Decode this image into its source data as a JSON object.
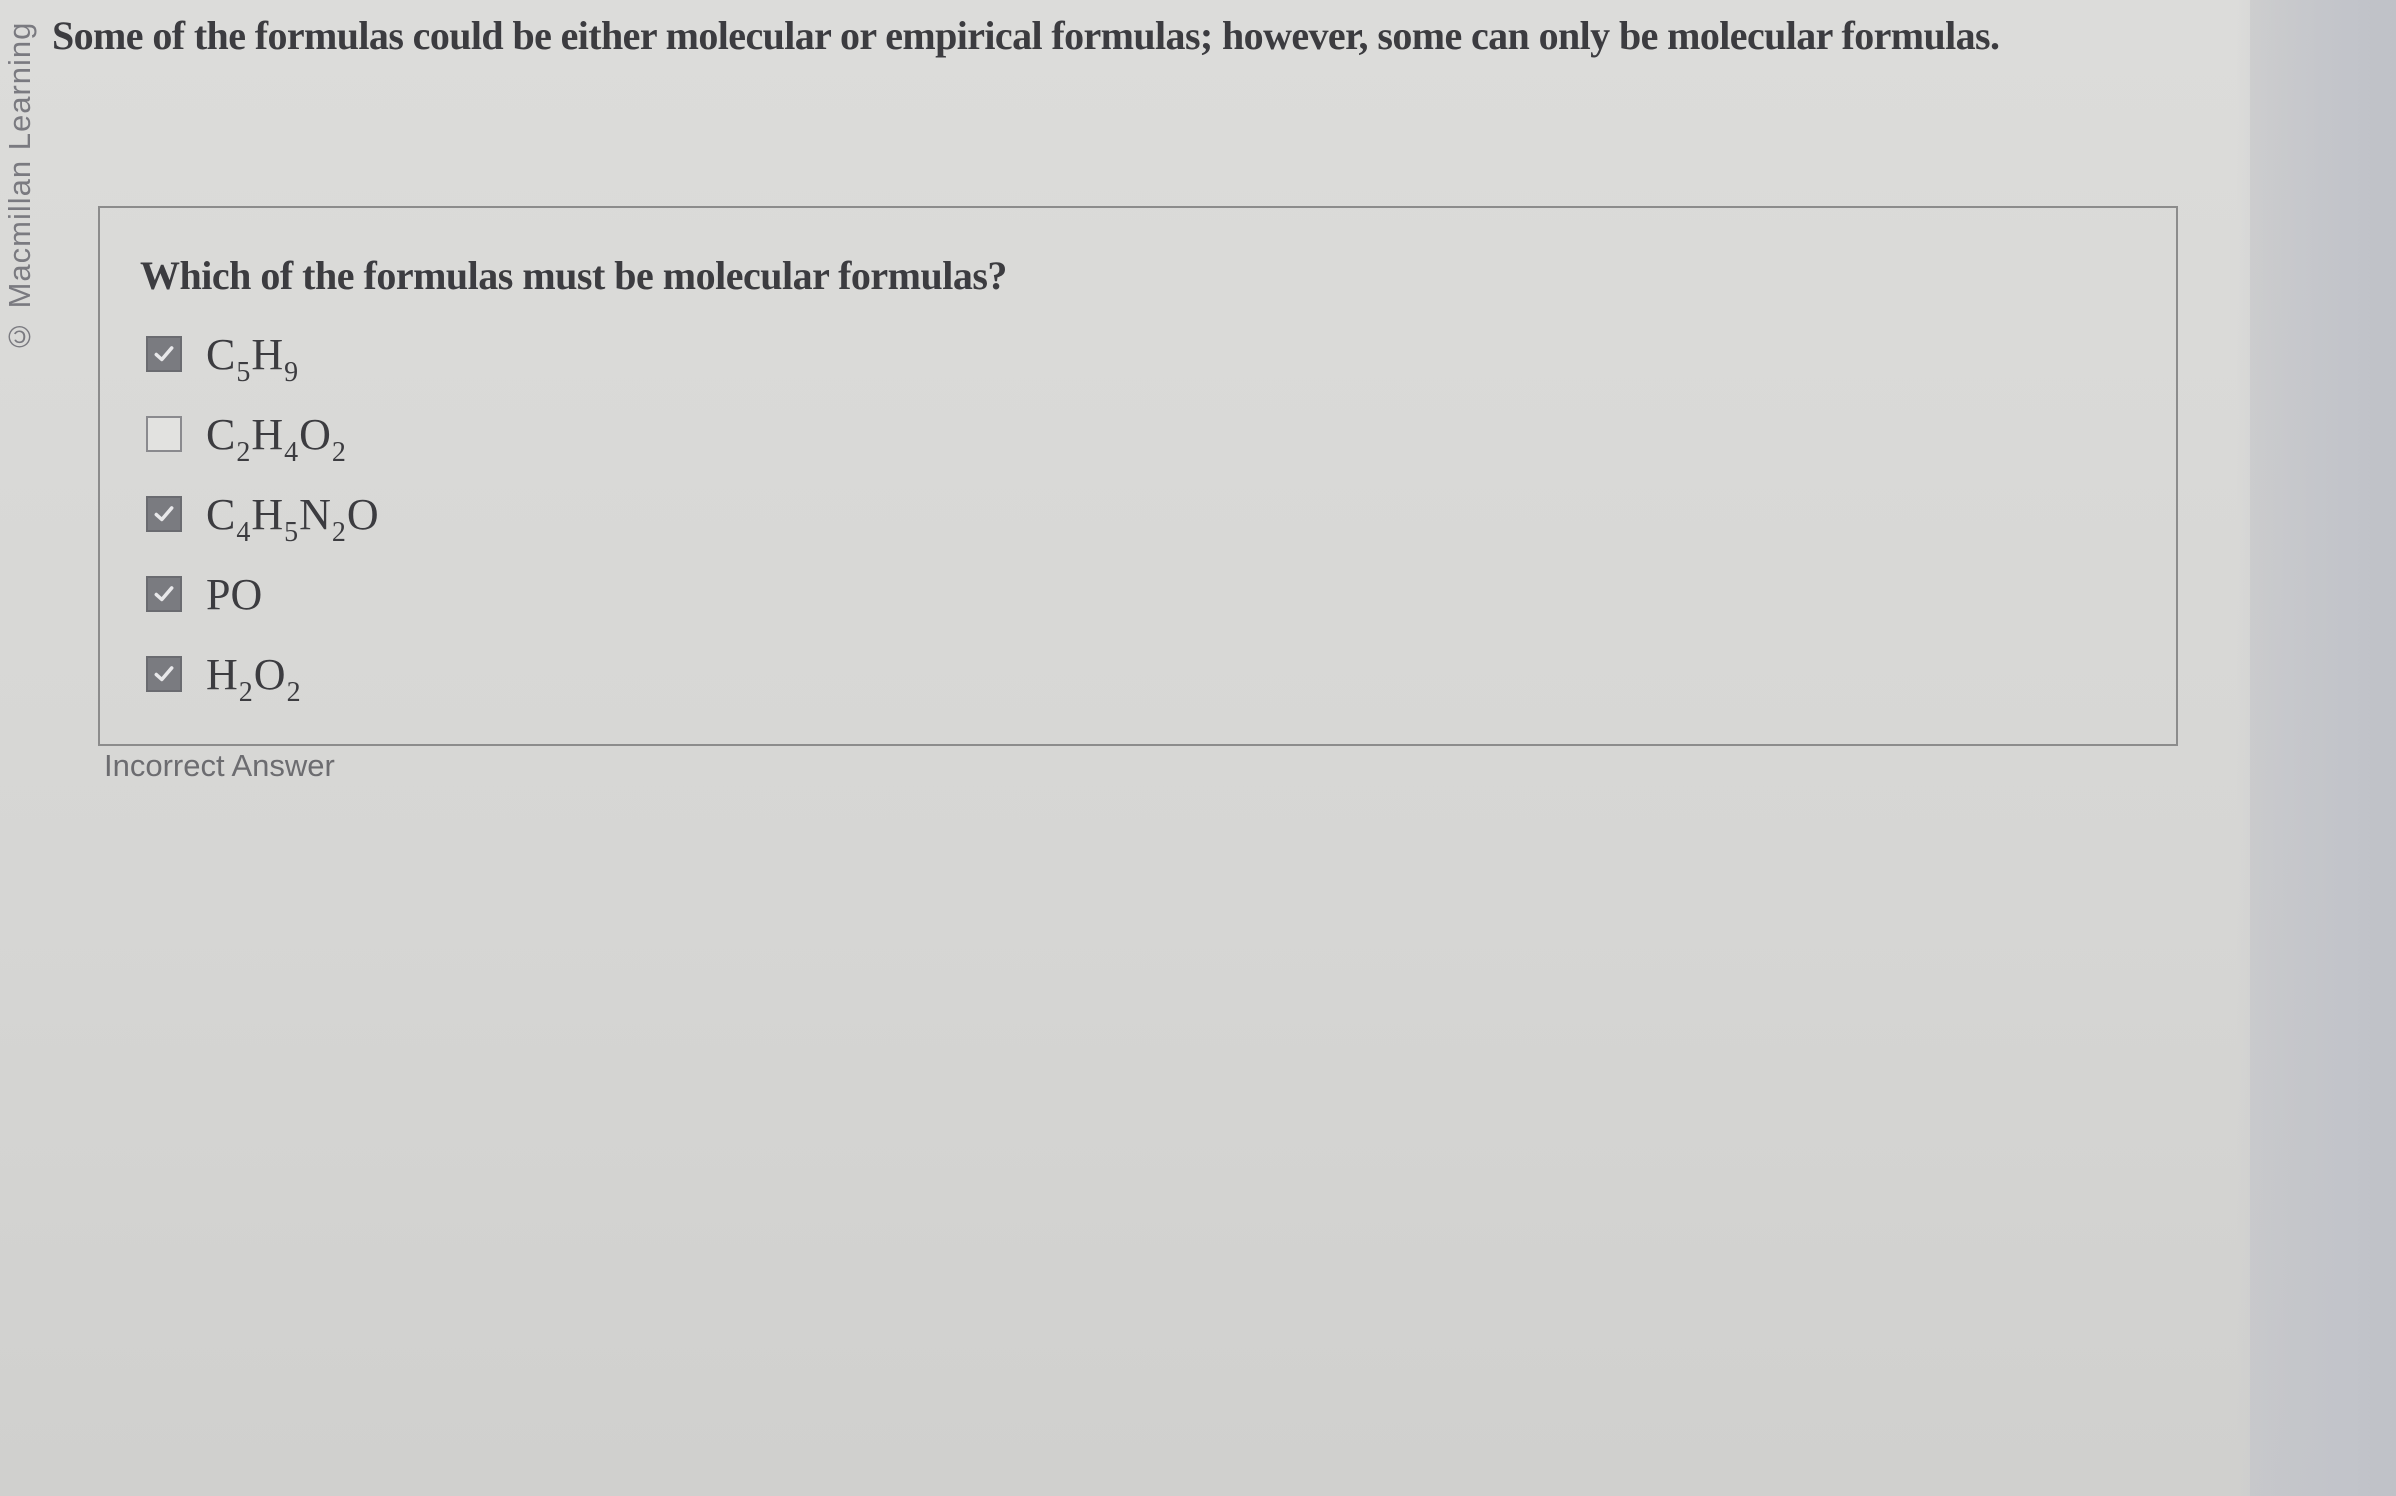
{
  "watermark": "© Macmillan Learning",
  "intro_text": "Some of the formulas could be either molecular or empirical formulas; however, some can only be molecular formulas.",
  "question": {
    "prompt": "Which of the formulas must be molecular formulas?",
    "options": [
      {
        "checked": true,
        "parts": [
          {
            "t": "C"
          },
          {
            "t": "5",
            "sub": true
          },
          {
            "t": "H"
          },
          {
            "t": "9",
            "sub": true
          }
        ]
      },
      {
        "checked": false,
        "parts": [
          {
            "t": "C"
          },
          {
            "t": "2",
            "sub": true
          },
          {
            "t": "H"
          },
          {
            "t": "4",
            "sub": true
          },
          {
            "t": "O"
          },
          {
            "t": "2",
            "sub": true
          }
        ]
      },
      {
        "checked": true,
        "parts": [
          {
            "t": "C"
          },
          {
            "t": "4",
            "sub": true
          },
          {
            "t": "H"
          },
          {
            "t": "5",
            "sub": true
          },
          {
            "t": "N"
          },
          {
            "t": "2",
            "sub": true
          },
          {
            "t": "O"
          }
        ]
      },
      {
        "checked": true,
        "parts": [
          {
            "t": "PO"
          }
        ]
      },
      {
        "checked": true,
        "parts": [
          {
            "t": "H"
          },
          {
            "t": "2",
            "sub": true
          },
          {
            "t": "O"
          },
          {
            "t": "2",
            "sub": true
          }
        ]
      }
    ]
  },
  "feedback": "Incorrect Answer",
  "colors": {
    "checkbox_checked": "#7a7b80",
    "checkmark": "#e8e8ea",
    "text": "#3c3c40"
  }
}
